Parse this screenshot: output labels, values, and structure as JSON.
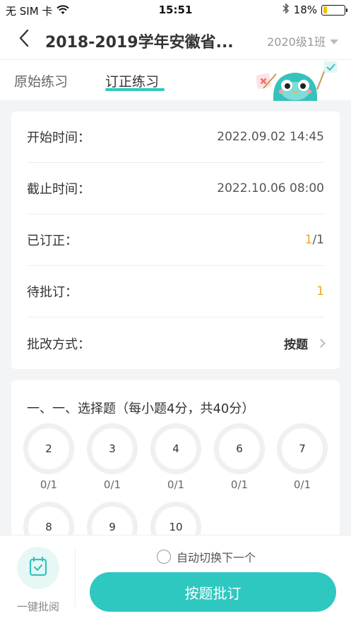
{
  "status_bar": {
    "carrier": "无 SIM 卡",
    "time": "15:51",
    "battery": "18%",
    "battery_level": 0.18
  },
  "nav": {
    "title": "2018-2019学年安徽省...",
    "class_select": "2020级1班"
  },
  "tabs": [
    {
      "label": "原始练习",
      "active": false
    },
    {
      "label": "订正练习",
      "active": true
    }
  ],
  "info": {
    "start_label": "开始时间：",
    "start_value": "2022.09.02 14:45",
    "end_label": "截止时间：",
    "end_value": "2022.10.06 08:00",
    "corrected_label": "已订正：",
    "corrected_done": "1",
    "corrected_total": "/1",
    "pending_label": "待批订：",
    "pending_value": "1",
    "method_label": "批改方式：",
    "method_value": "按题"
  },
  "section": {
    "title": "一、一、选择题（每小题4分，共40分）",
    "questions": [
      {
        "num": "2",
        "score": "0/1"
      },
      {
        "num": "3",
        "score": "0/1"
      },
      {
        "num": "4",
        "score": "0/1"
      },
      {
        "num": "6",
        "score": "0/1"
      },
      {
        "num": "7",
        "score": "0/1"
      },
      {
        "num": "8",
        "score": ""
      },
      {
        "num": "9",
        "score": ""
      },
      {
        "num": "10",
        "score": ""
      }
    ]
  },
  "bottom": {
    "quick_label": "一键批阅",
    "auto_switch": "自动切换下一个",
    "main_button": "按题批订"
  },
  "colors": {
    "accent": "#2ec8c0",
    "orange": "#f0a52a"
  }
}
